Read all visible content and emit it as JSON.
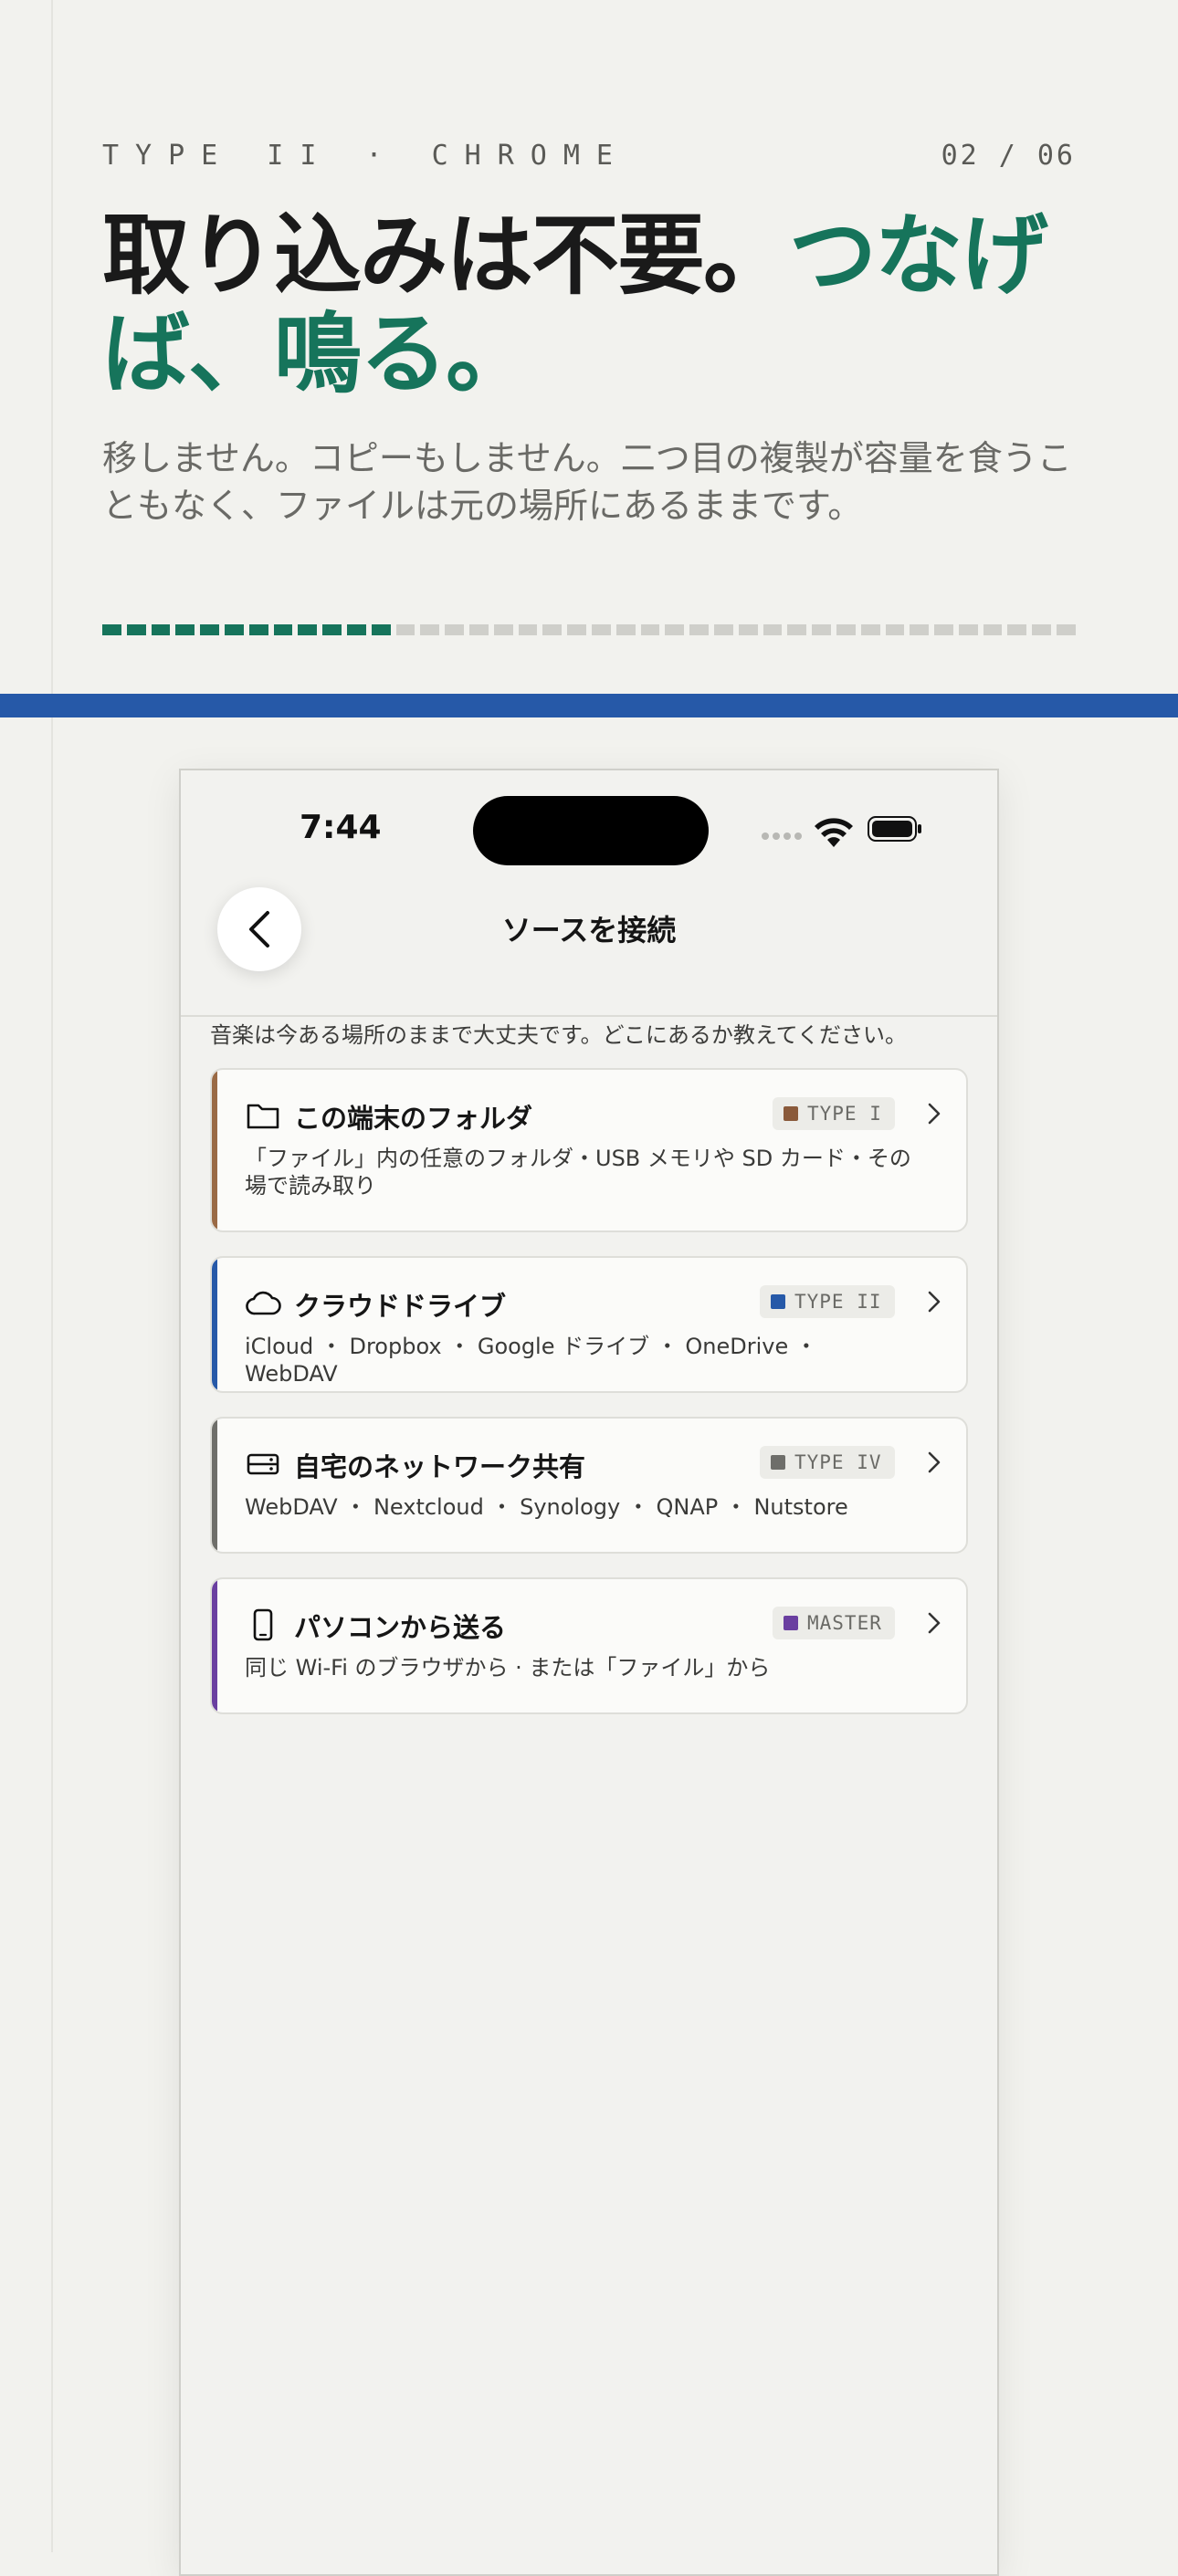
{
  "header": {
    "kicker": "TYPE II · CHROME",
    "page_count": "02 / 06",
    "headline_dark": "取り込みは不要。",
    "headline_accent": "つなげば、鳴る。",
    "lede": "移しません。コピーもしません。二つ目の複製が容量を食うこともなく、ファイルは元の場所にあるままです。"
  },
  "progress": {
    "filled_fraction": 0.31
  },
  "colors": {
    "accent_green": "#16745b",
    "band_blue": "#2659a8"
  },
  "phone": {
    "status": {
      "time": "7:44"
    },
    "nav": {
      "title": "ソースを接続",
      "back_icon": "chevron-left-icon"
    },
    "intro": "音楽は今ある場所のままで大丈夫です。どこにあるか教えてください。",
    "sources": [
      {
        "title": "この端末のフォルダ",
        "badge": "TYPE I",
        "badge_color": "#8a5a3b",
        "stripe_color": "#9a6a45",
        "icon": "folder-icon",
        "description": "「ファイル」内の任意のフォルダ・USB メモリや SD カード・その場で読み取り"
      },
      {
        "title": "クラウドドライブ",
        "badge": "TYPE II",
        "badge_color": "#2659a8",
        "stripe_color": "#2659a8",
        "icon": "cloud-icon",
        "description": "iCloud ・ Dropbox ・ Google ドライブ ・ OneDrive ・ WebDAV"
      },
      {
        "title": "自宅のネットワーク共有",
        "badge": "TYPE IV",
        "badge_color": "#6e6e6a",
        "stripe_color": "#6e6e6a",
        "icon": "server-icon",
        "description": "WebDAV ・ Nextcloud ・ Synology ・ QNAP ・ Nutstore"
      },
      {
        "title": "パソコンから送る",
        "badge": "MASTER",
        "badge_color": "#6a3fa0",
        "stripe_color": "#6a3fa0",
        "icon": "phone-icon",
        "description": "同じ Wi-Fi のブラウザから · または「ファイル」から"
      }
    ]
  }
}
